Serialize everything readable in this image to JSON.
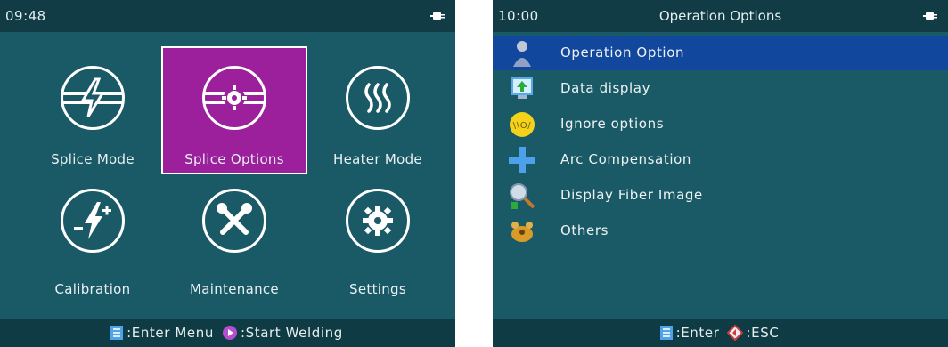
{
  "left": {
    "time": "09:48",
    "tiles": [
      {
        "label": "Splice Mode",
        "icon": "splice-mode-icon"
      },
      {
        "label": "Splice Options",
        "icon": "splice-options-icon"
      },
      {
        "label": "Heater Mode",
        "icon": "heater-icon"
      },
      {
        "label": "Calibration",
        "icon": "calibration-icon"
      },
      {
        "label": "Maintenance",
        "icon": "tools-icon"
      },
      {
        "label": "Settings",
        "icon": "gear-icon"
      }
    ],
    "selected_tile": "Splice Options",
    "footer": {
      "enter_label": ":Enter Menu",
      "start_label": ":Start Welding"
    }
  },
  "right": {
    "time": "10:00",
    "title": "Operation Options",
    "items": [
      {
        "label": "Operation Option",
        "icon": "operator-icon"
      },
      {
        "label": "Data display",
        "icon": "data-display-icon"
      },
      {
        "label": "Ignore options",
        "icon": "ignore-icon"
      },
      {
        "label": "Arc Compensation",
        "icon": "plus-icon"
      },
      {
        "label": "Display Fiber Image",
        "icon": "magnifier-icon"
      },
      {
        "label": "Others",
        "icon": "others-icon"
      }
    ],
    "selected_item": "Operation Option",
    "footer": {
      "enter_label": ":Enter",
      "esc_label": ":ESC"
    }
  },
  "colors": {
    "screen_bg": "#1a5a67",
    "bar_bg": "#113c45",
    "selected_tile": "#9c1f9c",
    "selected_row": "#12479e"
  }
}
